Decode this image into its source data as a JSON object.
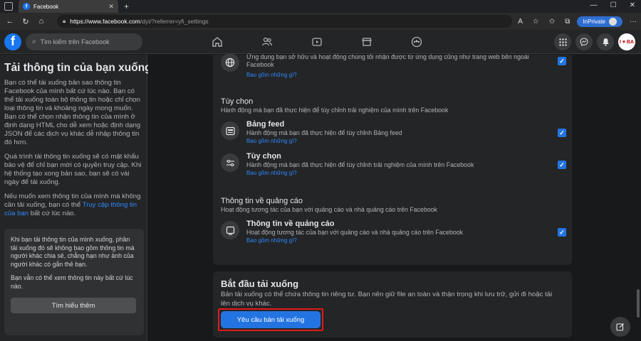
{
  "browser": {
    "tab_title": "Facebook",
    "url_host": "https://www.facebook.com",
    "url_rest": "/dyi/?referrer=yfi_settings",
    "inprivate_label": "InPrivate"
  },
  "fb": {
    "search_placeholder": "Tìm kiếm trên Facebook",
    "profile_text": "I ♥ BA"
  },
  "sidebar": {
    "title": "Tải thông tin của bạn xuống",
    "p1": "Bạn có thể tải xuống bản sao thông tin Facebook của mình bất cứ lúc nào. Bạn có thể tải xuống toàn bộ thông tin hoặc chỉ chọn loại thông tin và khoảng ngày mong muốn. Bạn có thể chọn nhận thông tin của mình ở định dạng HTML cho dễ xem hoặc định dạng JSON để các dịch vụ khác dễ nhập thông tin đó hơn.",
    "p2": "Quá trình tải thông tin xuống sẽ có mật khẩu bảo vệ để chỉ bạn mới có quyền truy cập. Khi hệ thống tạo xong bản sao, bạn sẽ có vài ngày để tải xuống.",
    "p3_before": "Nếu muốn xem thông tin của mình mà không cần tải xuống, bạn có thể ",
    "p3_link": "Truy cập thông tin của bạn",
    "p3_after": " bất cứ lúc nào.",
    "box_p1": "Khi bạn tải thông tin của mình xuống, phần tải xuống đó sẽ không bao gồm thông tin mà người khác chia sẻ, chẳng hạn như ảnh của người khác có gắn thẻ bạn.",
    "box_p2": "Bạn vẫn có thể xem thông tin này bất cứ lúc nào.",
    "learn_more": "Tìm hiểu thêm"
  },
  "main": {
    "top_row": {
      "desc": "Ứng dụng bạn sở hữu và hoạt động chúng tôi nhận được từ ứng dụng cũng như trang web bên ngoài Facebook",
      "link": "Bao gồm những gì?"
    },
    "section_prefs": {
      "title": "Tùy chọn",
      "desc": "Hành động mà bạn đã thực hiện để tùy chỉnh trải nghiệm của mình trên Facebook"
    },
    "row_feed": {
      "title": "Bảng feed",
      "desc": "Hành động mà bạn đã thực hiện để tùy chỉnh Bảng feed",
      "link": "Bao gồm những gì?"
    },
    "row_prefs": {
      "title": "Tùy chọn",
      "desc": "Hành động mà bạn đã thực hiện để tùy chỉnh trải nghiệm của mình trên Facebook",
      "link": "Bao gồm những gì?"
    },
    "section_ads": {
      "title": "Thông tin về quảng cáo",
      "desc": "Hoạt động tương tác của bạn với quảng cáo và nhà quảng cáo trên Facebook"
    },
    "row_ads": {
      "title": "Thông tin về quảng cáo",
      "desc": "Hoạt động tương tác của bạn với quảng cáo và nhà quảng cáo trên Facebook",
      "link": "Bao gồm những gì?"
    },
    "start": {
      "title": "Bắt đầu tải xuống",
      "desc": "Bản tải xuống có thể chứa thông tin riêng tư. Bạn nên giữ file an toàn và thận trọng khi lưu trữ, gửi đi hoặc tải lên dịch vụ khác.",
      "button": "Yêu cầu bản tải xuống"
    }
  },
  "colors": {
    "accent": "#2374e1",
    "highlight": "#e01b1b",
    "background": "#18191a",
    "card": "#242526"
  }
}
